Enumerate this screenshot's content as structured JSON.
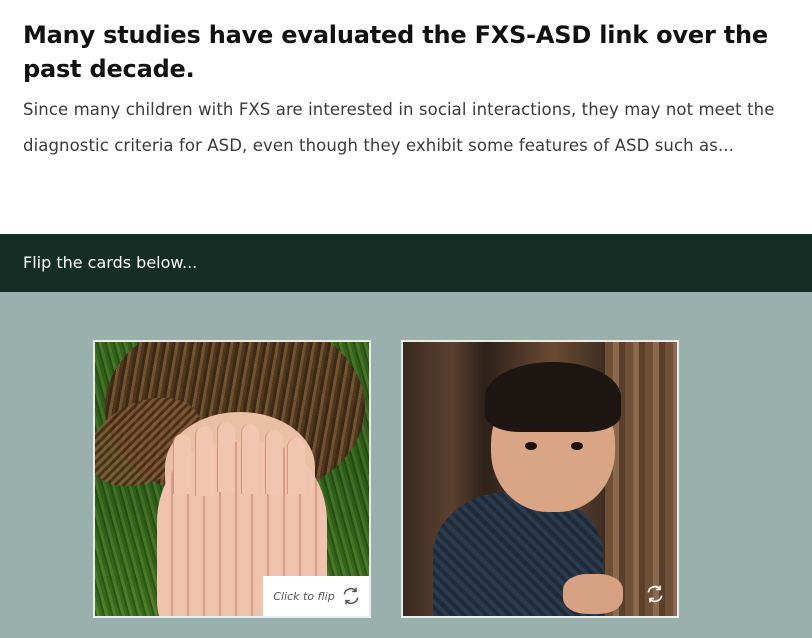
{
  "intro": {
    "heading": "Many studies have evaluated the FXS-ASD link over the past decade.",
    "paragraph": "Since many children with FXS are interested in social interactions, they may not meet the diagnostic criteria for ASD, even though they exhibit some features of ASD such as..."
  },
  "banner": {
    "text": "Flip the cards below..."
  },
  "cards": [
    {
      "flip_label": "Click to flip",
      "image_icon": "child-covering-face-image",
      "flip_icon": "flip-arrows-icon"
    },
    {
      "flip_label": "",
      "image_icon": "toddler-by-door-image",
      "flip_icon": "flip-arrows-icon"
    }
  ],
  "colors": {
    "banner_bg": "#142d25",
    "card_area_bg": "#9ab0ad",
    "heading": "#111111",
    "body_text": "#3a3a3a"
  }
}
